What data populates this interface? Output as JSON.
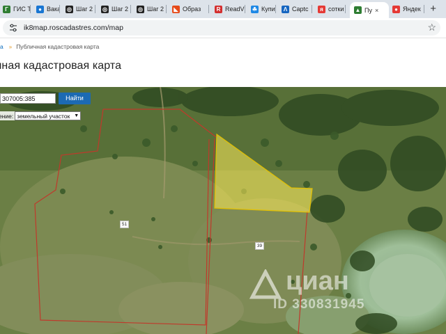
{
  "tabs": [
    {
      "label": "ГИС Т",
      "color": "#2e7d32",
      "glyph": "Г"
    },
    {
      "label": "Вакан",
      "color": "#1976d2",
      "glyph": "●"
    },
    {
      "label": "Шаг 2",
      "color": "#222222",
      "glyph": "◎"
    },
    {
      "label": "Шаг 2",
      "color": "#222222",
      "glyph": "◎"
    },
    {
      "label": "Шаг 2",
      "color": "#222222",
      "glyph": "◎"
    },
    {
      "label": "Образ",
      "color": "#e64a19",
      "glyph": "◣"
    },
    {
      "label": "ReadV",
      "color": "#d32f2f",
      "glyph": "R"
    },
    {
      "label": "Купит",
      "color": "#1e88e5",
      "glyph": "☘"
    },
    {
      "label": "Captc",
      "color": "#1565c0",
      "glyph": "Λ"
    },
    {
      "label": "сотки",
      "color": "#e53935",
      "glyph": "я"
    },
    {
      "label": "Пу",
      "color": "#2e7d32",
      "glyph": "▲",
      "active": true
    },
    {
      "label": "Яндек",
      "color": "#e53935",
      "glyph": "●"
    }
  ],
  "newtab_label": "+",
  "tab_close": "×",
  "address": {
    "url": "ik8map.roscadastres.com/map"
  },
  "breadcrumb": {
    "home": "а",
    "current": "Публичная кадастровая карта"
  },
  "page_title": "чная кадастровая карта",
  "search": {
    "value": "307005:385",
    "button": "Найти"
  },
  "filter": {
    "label": "ение:",
    "selected": "земельный участок"
  },
  "parcels": [
    {
      "number": "51"
    },
    {
      "number": "39"
    }
  ],
  "watermark": {
    "brand": "циан",
    "id": "ID 330831945"
  }
}
